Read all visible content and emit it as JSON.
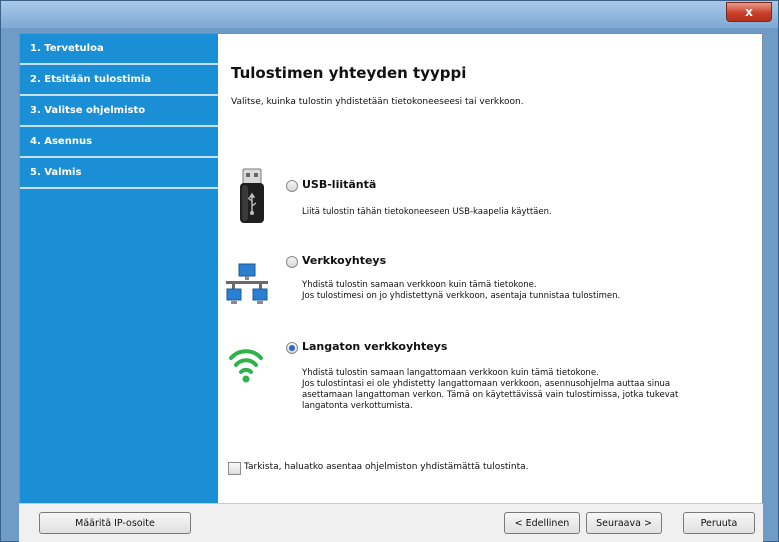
{
  "window": {
    "close_label": "x"
  },
  "sidebar": {
    "items": [
      {
        "label": "1. Tervetuloa"
      },
      {
        "label": "2. Etsitään tulostimia"
      },
      {
        "label": "3. Valitse ohjelmisto"
      },
      {
        "label": "4. Asennus"
      },
      {
        "label": "5. Valmis"
      }
    ]
  },
  "main": {
    "title": "Tulostimen yhteyden tyyppi",
    "description": "Valitse, kuinka tulostin yhdistetään tietokoneeseesi tai verkkoon.",
    "options": [
      {
        "icon": "usb-icon",
        "label": "USB-liitäntä",
        "desc1": "Liitä tulostin tähän tietokoneeseen USB-kaapelia käyttäen.",
        "desc2": "",
        "desc3": "",
        "desc4": "",
        "selected": false
      },
      {
        "icon": "network-icon",
        "label": "Verkkoyhteys",
        "desc1": "Yhdistä tulostin samaan verkkoon kuin tämä tietokone.",
        "desc2": "Jos tulostimesi on jo yhdistettynä verkkoon, asentaja tunnistaa tulostimen.",
        "desc3": "",
        "desc4": "",
        "selected": false
      },
      {
        "icon": "wifi-icon",
        "label": "Langaton verkkoyhteys",
        "desc1": "Yhdistä tulostin samaan langattomaan verkkoon kuin tämä tietokone.",
        "desc2": "Jos tulostintasi ei ole yhdistetty langattomaan verkkoon, asennusohjelma auttaa sinua",
        "desc3": "asettamaan langattoman verkon. Tämä on käytettävissä vain tulostimissa, jotka tukevat",
        "desc4": "langatonta verkottumista.",
        "selected": true
      }
    ],
    "checkbox_label": "Tarkista, haluatko asentaa ohjelmiston yhdistämättä tulostinta.",
    "checkbox_checked": false
  },
  "footer": {
    "ip_button": "Määritä IP-osoite",
    "back_button": "< Edellinen",
    "next_button": "Seuraava >",
    "cancel_button": "Peruuta"
  },
  "colors": {
    "sidebar_bg": "#1a8fd6",
    "window_chrome": "#6f9cc7",
    "wifi_green": "#2fb24a",
    "network_blue": "#2a7fd0"
  }
}
